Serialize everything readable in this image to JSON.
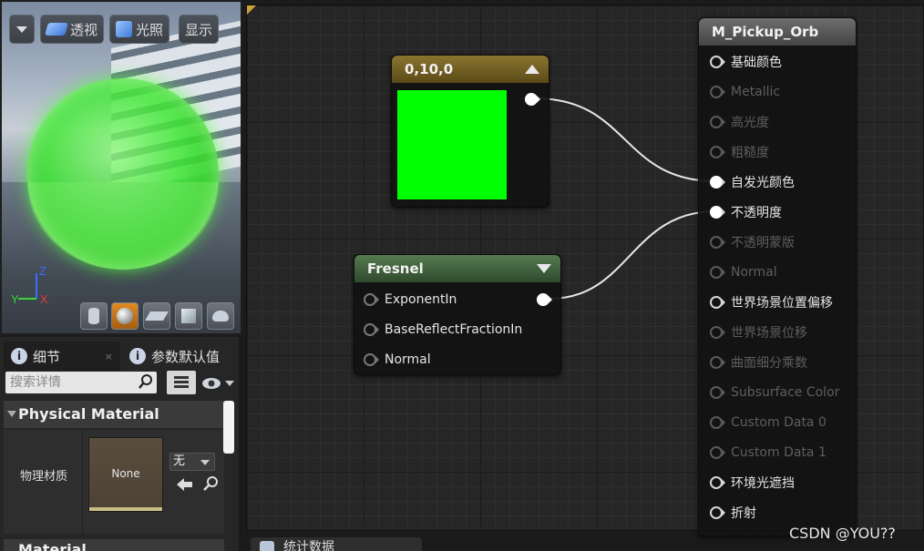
{
  "viewport": {
    "perspective_label": "透视",
    "lighting_label": "光照",
    "show_label": "显示",
    "axis_z": "Z",
    "axis_y": "Y",
    "axis_x": "X",
    "preview_color": "#3fe02a"
  },
  "details": {
    "tab_details": "细节",
    "tab_params": "参数默认值",
    "search_placeholder": "搜索详情",
    "category": "Physical Material",
    "prop_label": "物理材质",
    "thumb_text": "None",
    "combo_value": "无",
    "category2": "Material"
  },
  "graph": {
    "constant_node": {
      "title": "0,10,0",
      "color": "#00ff00",
      "header_color": "#7a6524"
    },
    "fresnel_node": {
      "title": "Fresnel",
      "header_color": "#4b6a47",
      "inputs": [
        "ExponentIn",
        "BaseReflectFractionIn",
        "Normal"
      ]
    },
    "material_node": {
      "title": "M_Pickup_Orb",
      "pins": [
        {
          "label": "基础颜色",
          "active": true,
          "connected": false
        },
        {
          "label": "Metallic",
          "active": false,
          "connected": false
        },
        {
          "label": "高光度",
          "active": false,
          "connected": false
        },
        {
          "label": "粗糙度",
          "active": false,
          "connected": false
        },
        {
          "label": "自发光颜色",
          "active": true,
          "connected": true
        },
        {
          "label": "不透明度",
          "active": true,
          "connected": true
        },
        {
          "label": "不透明蒙版",
          "active": false,
          "connected": false
        },
        {
          "label": "Normal",
          "active": false,
          "connected": false
        },
        {
          "label": "世界场景位置偏移",
          "active": true,
          "connected": false
        },
        {
          "label": "世界场景位移",
          "active": false,
          "connected": false
        },
        {
          "label": "曲面细分乘数",
          "active": false,
          "connected": false
        },
        {
          "label": "Subsurface Color",
          "active": false,
          "connected": false
        },
        {
          "label": "Custom Data 0",
          "active": false,
          "connected": false
        },
        {
          "label": "Custom Data 1",
          "active": false,
          "connected": false
        },
        {
          "label": "环境光遮挡",
          "active": true,
          "connected": false
        },
        {
          "label": "折射",
          "active": true,
          "connected": false
        }
      ]
    }
  },
  "bottom": {
    "tab_label": "统计数据"
  },
  "watermark": "CSDN @YOU??"
}
